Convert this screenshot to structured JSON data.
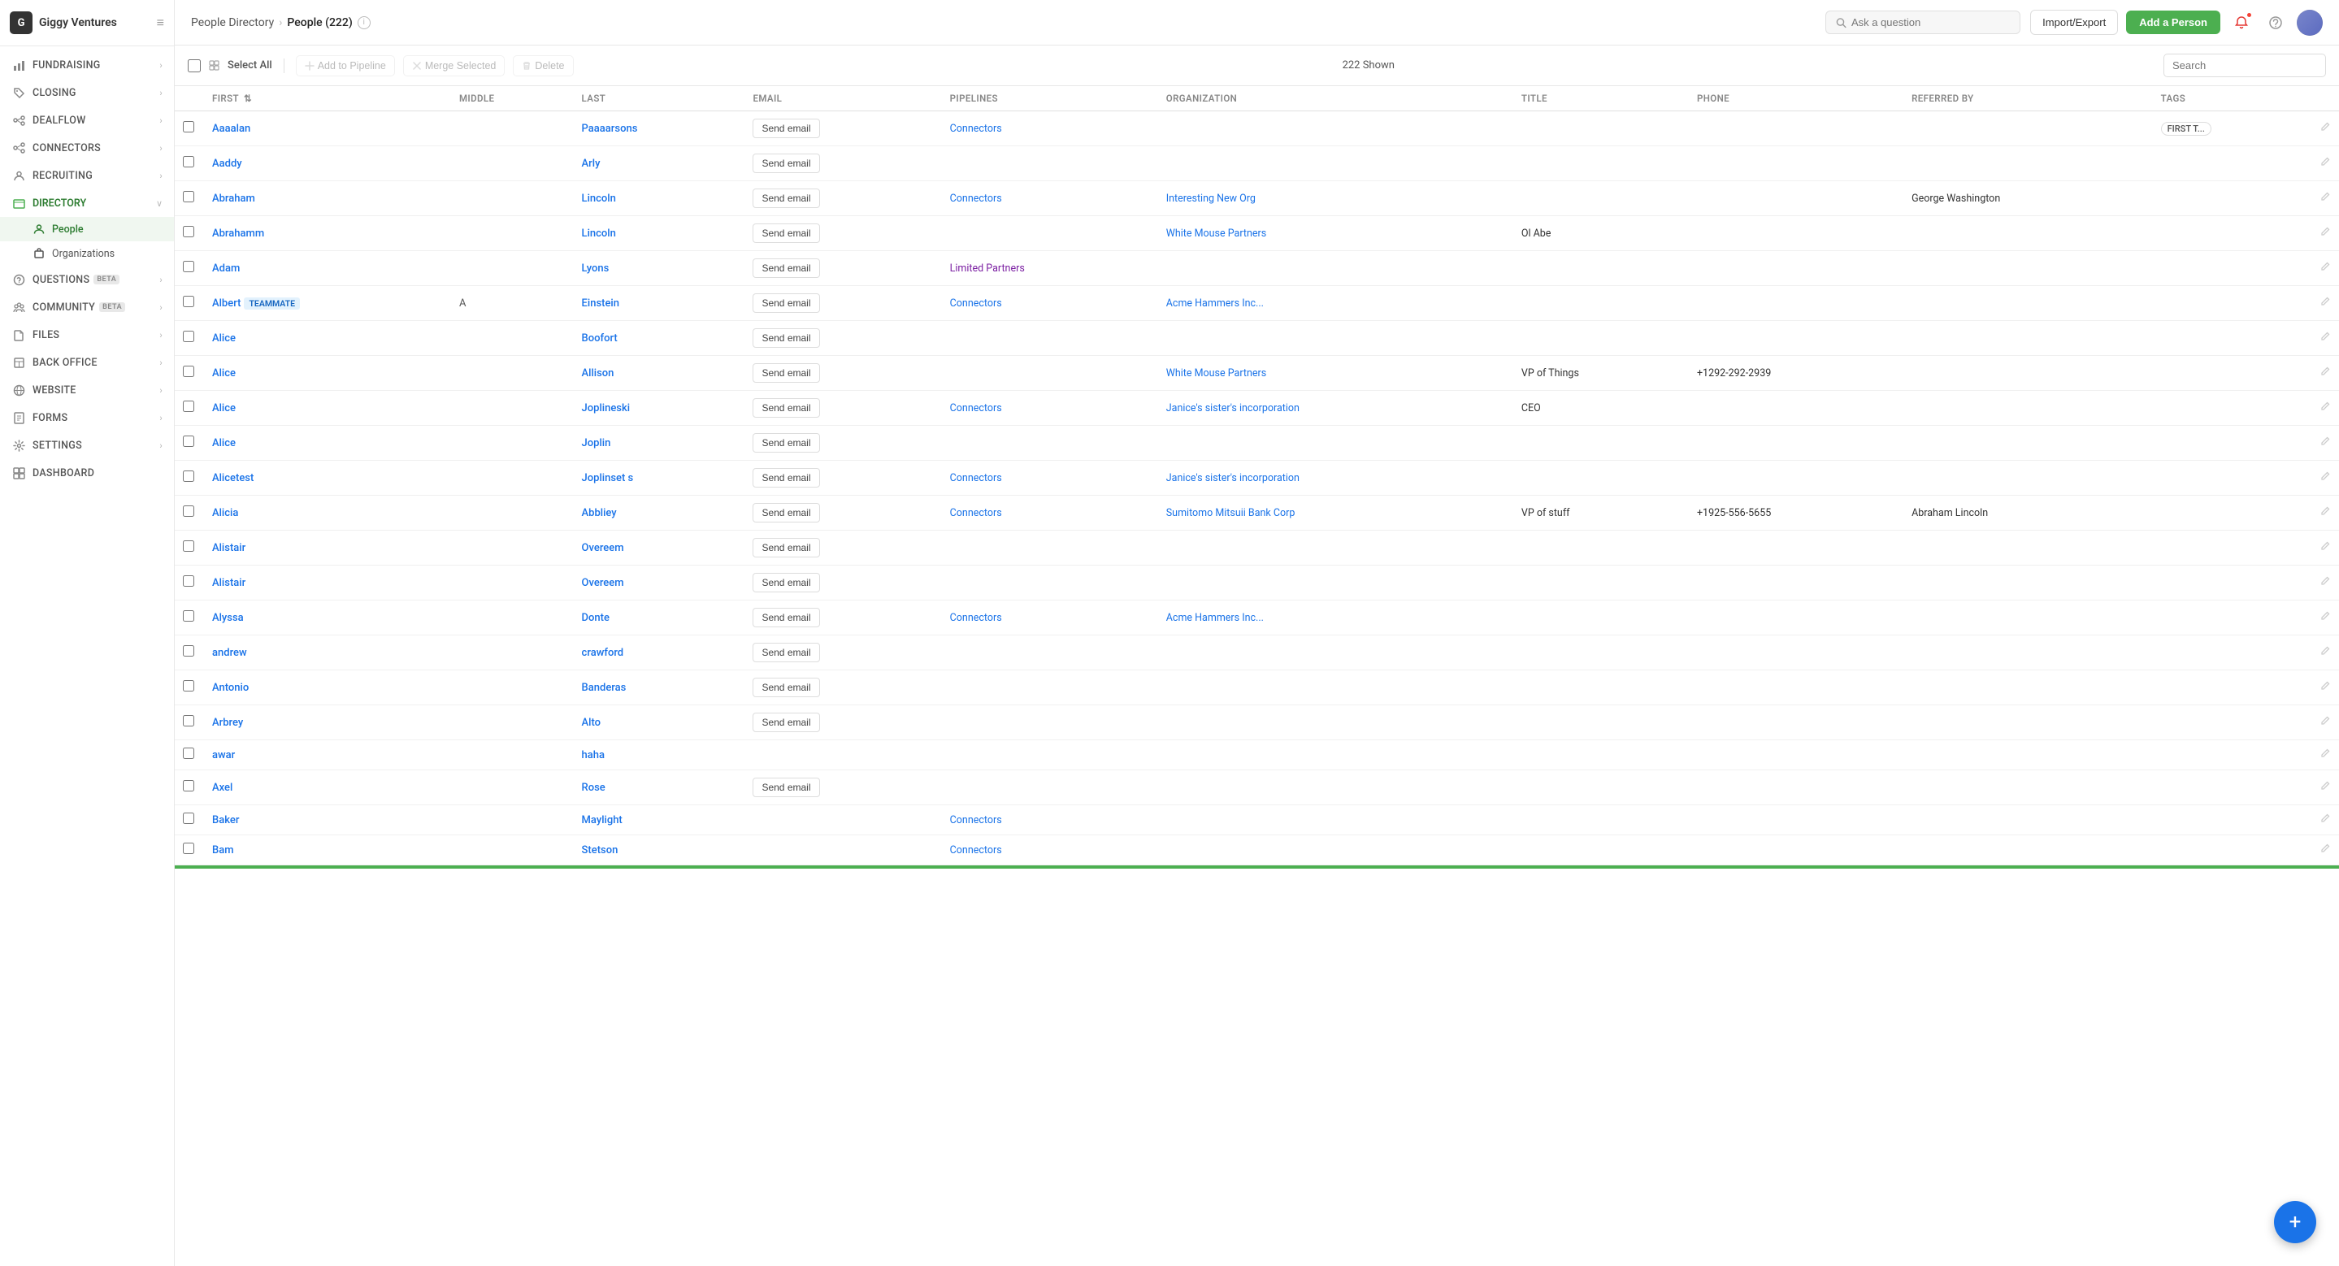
{
  "app": {
    "company": "Giggy Ventures",
    "logo_letter": "G"
  },
  "sidebar": {
    "nav_items": [
      {
        "id": "fundraising",
        "label": "FUNDRAISING",
        "icon": "chart-icon",
        "has_arrow": true,
        "active": false
      },
      {
        "id": "closing",
        "label": "CLOSING",
        "icon": "tag-icon",
        "has_arrow": true,
        "active": false
      },
      {
        "id": "dealflow",
        "label": "DEALFLOW",
        "icon": "flow-icon",
        "has_arrow": true,
        "active": false
      },
      {
        "id": "connectors",
        "label": "CONNECTORS",
        "icon": "connect-icon",
        "has_arrow": true,
        "active": false
      },
      {
        "id": "recruiting",
        "label": "RECRUITING",
        "icon": "recruit-icon",
        "has_arrow": true,
        "active": false
      }
    ],
    "directory": {
      "label": "DIRECTORY",
      "icon": "directory-icon",
      "expanded": true,
      "children": [
        {
          "id": "people",
          "label": "People",
          "icon": "people-icon",
          "active": true
        },
        {
          "id": "organizations",
          "label": "Organizations",
          "icon": "org-icon",
          "active": false
        }
      ]
    },
    "nav_items2": [
      {
        "id": "questions",
        "label": "QUESTIONS",
        "icon": "q-icon",
        "has_arrow": true,
        "beta": true
      },
      {
        "id": "community",
        "label": "COMMUNITY",
        "icon": "community-icon",
        "has_arrow": true,
        "beta": true
      },
      {
        "id": "files",
        "label": "FILES",
        "icon": "files-icon",
        "has_arrow": true
      },
      {
        "id": "back-office",
        "label": "BACK OFFICE",
        "icon": "office-icon",
        "has_arrow": true
      },
      {
        "id": "website",
        "label": "WEBSITE",
        "icon": "website-icon",
        "has_arrow": true
      },
      {
        "id": "forms",
        "label": "FORMS",
        "icon": "forms-icon",
        "has_arrow": true
      },
      {
        "id": "settings",
        "label": "SETTINGS",
        "icon": "settings-icon",
        "has_arrow": true
      },
      {
        "id": "dashboard",
        "label": "DASHBOARD",
        "icon": "dashboard-icon",
        "has_arrow": false
      }
    ]
  },
  "topbar": {
    "breadcrumb_parent": "People Directory",
    "breadcrumb_child": "People (222)",
    "search_placeholder": "Ask a question",
    "import_export_label": "Import/Export",
    "add_person_label": "Add a Person"
  },
  "toolbar": {
    "select_all_label": "Select All",
    "add_to_pipeline_label": "Add to Pipeline",
    "merge_selected_label": "Merge Selected",
    "delete_label": "Delete",
    "shown_count": "222 Shown",
    "search_placeholder": "Search"
  },
  "table": {
    "columns": [
      "",
      "FIRST",
      "MIDDLE",
      "LAST",
      "EMAIL",
      "PIPELINES",
      "ORGANIZATION",
      "TITLE",
      "PHONE",
      "REFERRED BY",
      "TAGS",
      ""
    ],
    "rows": [
      {
        "first": "Aaaalan",
        "middle": "",
        "last": "Paaaarsons",
        "email": true,
        "pipelines": "Connectors",
        "pipeline_type": "connectors",
        "organization": "",
        "title": "",
        "phone": "",
        "referred_by": "",
        "tags": "FIRST T..."
      },
      {
        "first": "Aaddy",
        "middle": "",
        "last": "Arly",
        "email": true,
        "pipelines": "",
        "pipeline_type": "",
        "organization": "",
        "title": "",
        "phone": "",
        "referred_by": "",
        "tags": ""
      },
      {
        "first": "Abraham",
        "middle": "",
        "last": "Lincoln",
        "email": true,
        "pipelines": "Connectors",
        "pipeline_type": "connectors",
        "organization": "Interesting New Org",
        "title": "",
        "phone": "",
        "referred_by": "George Washington",
        "tags": ""
      },
      {
        "first": "Abrahamm",
        "middle": "",
        "last": "Lincoln",
        "email": true,
        "pipelines": "",
        "pipeline_type": "",
        "organization": "White Mouse Partners",
        "title": "Ol Abe",
        "phone": "",
        "referred_by": "",
        "tags": ""
      },
      {
        "first": "Adam",
        "middle": "",
        "last": "Lyons",
        "email": true,
        "pipelines": "Limited Partners",
        "pipeline_type": "limited-partners",
        "organization": "",
        "title": "",
        "phone": "",
        "referred_by": "",
        "tags": ""
      },
      {
        "first": "Albert",
        "middle": "A",
        "last": "Einstein",
        "email": true,
        "pipelines": "Connectors",
        "pipeline_type": "connectors",
        "organization": "Acme Hammers Inc...",
        "title": "",
        "phone": "",
        "referred_by": "",
        "tags": "",
        "teammate": true
      },
      {
        "first": "Alice",
        "middle": "",
        "last": "Boofort",
        "email": true,
        "pipelines": "",
        "pipeline_type": "",
        "organization": "",
        "title": "",
        "phone": "",
        "referred_by": "",
        "tags": ""
      },
      {
        "first": "Alice",
        "middle": "",
        "last": "Allison",
        "email": true,
        "pipelines": "",
        "pipeline_type": "",
        "organization": "White Mouse Partners",
        "title": "VP of Things",
        "phone": "+1292-292-2939",
        "referred_by": "",
        "tags": ""
      },
      {
        "first": "Alice",
        "middle": "",
        "last": "Joplineski",
        "email": true,
        "pipelines": "Connectors",
        "pipeline_type": "connectors",
        "organization": "Janice's sister's incorporation",
        "title": "CEO",
        "phone": "",
        "referred_by": "",
        "tags": ""
      },
      {
        "first": "Alice",
        "middle": "",
        "last": "Joplin",
        "email": true,
        "pipelines": "",
        "pipeline_type": "",
        "organization": "",
        "title": "",
        "phone": "",
        "referred_by": "",
        "tags": ""
      },
      {
        "first": "Alicetest",
        "middle": "",
        "last": "Joplinset s",
        "email": true,
        "pipelines": "Connectors",
        "pipeline_type": "connectors",
        "organization": "Janice's sister's incorporation",
        "title": "",
        "phone": "",
        "referred_by": "",
        "tags": ""
      },
      {
        "first": "Alicia",
        "middle": "",
        "last": "Abbliey",
        "email": true,
        "pipelines": "Connectors",
        "pipeline_type": "connectors",
        "organization": "Sumitomo Mitsuii Bank Corp",
        "title": "VP of stuff",
        "phone": "+1925-556-5655",
        "referred_by": "Abraham Lincoln",
        "tags": ""
      },
      {
        "first": "Alistair",
        "middle": "",
        "last": "Overeem",
        "email": true,
        "pipelines": "",
        "pipeline_type": "",
        "organization": "",
        "title": "",
        "phone": "",
        "referred_by": "",
        "tags": ""
      },
      {
        "first": "Alistair",
        "middle": "",
        "last": "Overeem",
        "email": true,
        "pipelines": "",
        "pipeline_type": "",
        "organization": "",
        "title": "",
        "phone": "",
        "referred_by": "",
        "tags": ""
      },
      {
        "first": "Alyssa",
        "middle": "",
        "last": "Donte",
        "email": true,
        "pipelines": "Connectors",
        "pipeline_type": "connectors",
        "organization": "Acme Hammers Inc...",
        "title": "",
        "phone": "",
        "referred_by": "",
        "tags": ""
      },
      {
        "first": "andrew",
        "middle": "",
        "last": "crawford",
        "email": true,
        "pipelines": "",
        "pipeline_type": "",
        "organization": "",
        "title": "",
        "phone": "",
        "referred_by": "",
        "tags": ""
      },
      {
        "first": "Antonio",
        "middle": "",
        "last": "Banderas",
        "email": true,
        "pipelines": "",
        "pipeline_type": "",
        "organization": "",
        "title": "",
        "phone": "",
        "referred_by": "",
        "tags": ""
      },
      {
        "first": "Arbrey",
        "middle": "",
        "last": "Alto",
        "email": true,
        "pipelines": "",
        "pipeline_type": "",
        "organization": "",
        "title": "",
        "phone": "",
        "referred_by": "",
        "tags": ""
      },
      {
        "first": "awar",
        "middle": "",
        "last": "haha",
        "email": false,
        "pipelines": "",
        "pipeline_type": "",
        "organization": "",
        "title": "",
        "phone": "",
        "referred_by": "",
        "tags": ""
      },
      {
        "first": "Axel",
        "middle": "",
        "last": "Rose",
        "email": true,
        "pipelines": "",
        "pipeline_type": "",
        "organization": "",
        "title": "",
        "phone": "",
        "referred_by": "",
        "tags": ""
      },
      {
        "first": "Baker",
        "middle": "",
        "last": "Maylight",
        "email": false,
        "pipelines": "Connectors",
        "pipeline_type": "connectors",
        "organization": "",
        "title": "",
        "phone": "",
        "referred_by": "",
        "tags": ""
      },
      {
        "first": "Bam",
        "middle": "",
        "last": "Stetson",
        "email": false,
        "pipelines": "Connectors",
        "pipeline_type": "connectors",
        "organization": "",
        "title": "",
        "phone": "",
        "referred_by": "",
        "tags": ""
      }
    ],
    "send_email_label": "Send email"
  },
  "fab": {
    "icon": "plus-icon",
    "label": "+"
  }
}
